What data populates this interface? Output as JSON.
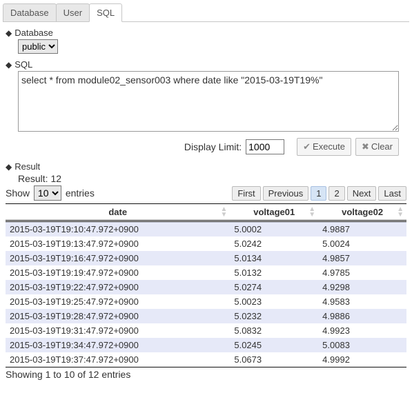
{
  "tabs": [
    {
      "label": "Database",
      "active": false
    },
    {
      "label": "User",
      "active": false
    },
    {
      "label": "SQL",
      "active": true
    }
  ],
  "section_database": {
    "title": "Database",
    "selected": "public"
  },
  "section_sql": {
    "title": "SQL",
    "query": "select * from module02_sensor003 where date like \"2015-03-19T19%\""
  },
  "actions": {
    "display_limit_label": "Display Limit:",
    "display_limit_value": "1000",
    "execute_label": "Execute",
    "clear_label": "Clear"
  },
  "section_result": {
    "title": "Result",
    "count_text": "Result: 12"
  },
  "datatable": {
    "show_label_prefix": "Show",
    "show_label_suffix": "entries",
    "length_value": "10",
    "pager": {
      "first": "First",
      "previous": "Previous",
      "next": "Next",
      "last": "Last",
      "pages": [
        "1",
        "2"
      ],
      "current": "1"
    },
    "columns": [
      "date",
      "voltage01",
      "voltage02"
    ],
    "rows": [
      {
        "date": "2015-03-19T19:10:47.972+0900",
        "voltage01": "5.0002",
        "voltage02": "4.9887"
      },
      {
        "date": "2015-03-19T19:13:47.972+0900",
        "voltage01": "5.0242",
        "voltage02": "5.0024"
      },
      {
        "date": "2015-03-19T19:16:47.972+0900",
        "voltage01": "5.0134",
        "voltage02": "4.9857"
      },
      {
        "date": "2015-03-19T19:19:47.972+0900",
        "voltage01": "5.0132",
        "voltage02": "4.9785"
      },
      {
        "date": "2015-03-19T19:22:47.972+0900",
        "voltage01": "5.0274",
        "voltage02": "4.9298"
      },
      {
        "date": "2015-03-19T19:25:47.972+0900",
        "voltage01": "5.0023",
        "voltage02": "4.9583"
      },
      {
        "date": "2015-03-19T19:28:47.972+0900",
        "voltage01": "5.0232",
        "voltage02": "4.9886"
      },
      {
        "date": "2015-03-19T19:31:47.972+0900",
        "voltage01": "5.0832",
        "voltage02": "4.9923"
      },
      {
        "date": "2015-03-19T19:34:47.972+0900",
        "voltage01": "5.0245",
        "voltage02": "5.0083"
      },
      {
        "date": "2015-03-19T19:37:47.972+0900",
        "voltage01": "5.0673",
        "voltage02": "4.9992"
      }
    ],
    "info": "Showing 1 to 10 of 12 entries"
  }
}
